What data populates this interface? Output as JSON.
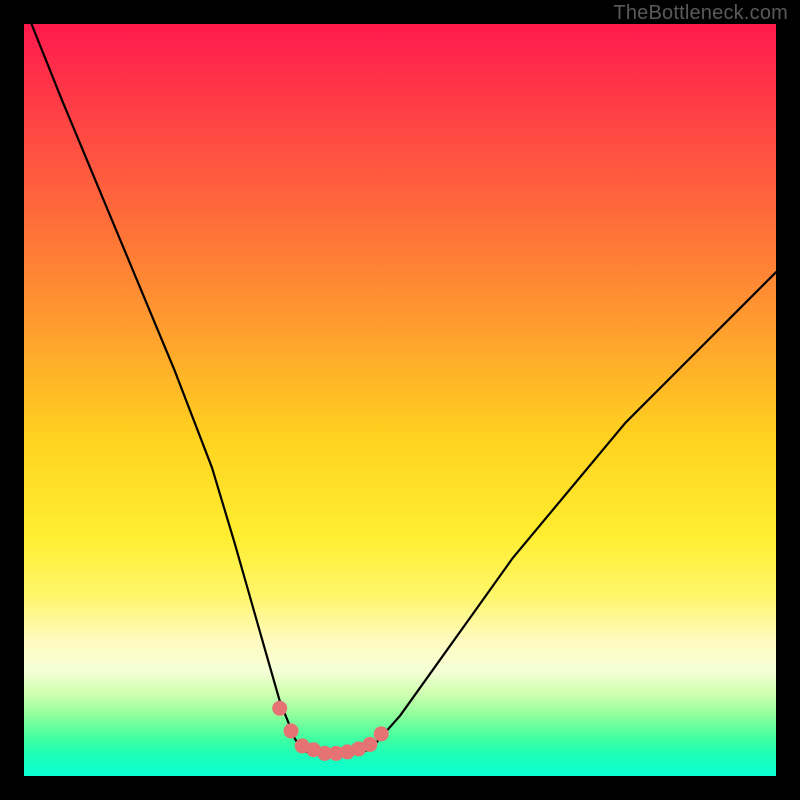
{
  "watermark": "TheBottleneck.com",
  "chart_data": {
    "type": "line",
    "title": "",
    "xlabel": "",
    "ylabel": "",
    "xlim": [
      0,
      100
    ],
    "ylim": [
      0,
      100
    ],
    "grid": false,
    "series": [
      {
        "name": "bottleneck-curve",
        "color": "#000000",
        "x": [
          1,
          5,
          10,
          15,
          20,
          25,
          28,
          30,
          32,
          34,
          36,
          37,
          38,
          40,
          42,
          44,
          46,
          50,
          55,
          60,
          65,
          70,
          75,
          80,
          85,
          90,
          95,
          100
        ],
        "values": [
          100,
          90,
          78,
          66,
          54,
          41,
          31,
          24,
          17,
          10,
          5,
          3.5,
          3,
          3,
          3,
          3,
          3.5,
          8,
          15,
          22,
          29,
          35,
          41,
          47,
          52,
          57,
          62,
          67
        ]
      },
      {
        "name": "highlight-dots",
        "color": "#e57373",
        "x": [
          34,
          35.5,
          37,
          38.5,
          40,
          41.5,
          43,
          44.5,
          46,
          47.5
        ],
        "values": [
          9,
          6,
          4,
          3.5,
          3,
          3,
          3.2,
          3.6,
          4.2,
          5.6
        ]
      }
    ]
  },
  "colors": {
    "frame": "#000000",
    "curve": "#000000",
    "dots": "#e57373",
    "watermark": "#5a5a5a"
  }
}
